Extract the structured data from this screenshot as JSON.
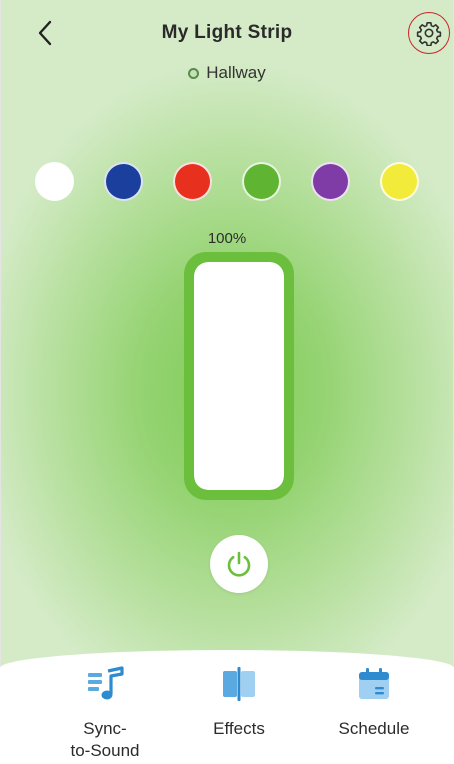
{
  "header": {
    "title": "My Light Strip",
    "location": "Hallway",
    "back_icon": "chevron-left-icon",
    "settings_icon": "gear-icon"
  },
  "colors": {
    "swatches": [
      {
        "name": "white",
        "hex": "#ffffff"
      },
      {
        "name": "blue",
        "hex": "#1a3f9c"
      },
      {
        "name": "red",
        "hex": "#e8301e"
      },
      {
        "name": "green",
        "hex": "#5fb432"
      },
      {
        "name": "purple",
        "hex": "#7f3ba6"
      },
      {
        "name": "yellow",
        "hex": "#f2eb3a"
      }
    ],
    "accent": "#6cbf3c",
    "highlight_ring": "#c8242b"
  },
  "brightness": {
    "label": "100%",
    "value": 100
  },
  "power": {
    "icon": "power-icon",
    "state": "on"
  },
  "tabs": [
    {
      "id": "sync",
      "label": "Sync-\nto-Sound",
      "icon": "music-note-icon"
    },
    {
      "id": "effects",
      "label": "Effects",
      "icon": "effects-icon"
    },
    {
      "id": "schedule",
      "label": "Schedule",
      "icon": "calendar-icon"
    }
  ]
}
